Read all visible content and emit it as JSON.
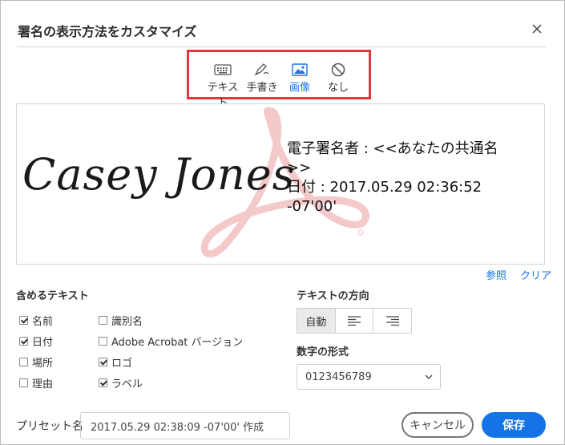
{
  "dialog": {
    "title": "署名の表示方法をカスタマイズ"
  },
  "modes": [
    {
      "label": "テキスト",
      "icon": "keyboard-icon"
    },
    {
      "label": "手書き",
      "icon": "pen-icon"
    },
    {
      "label": "画像",
      "icon": "image-icon",
      "active": true
    },
    {
      "label": "なし",
      "icon": "none-icon"
    }
  ],
  "preview": {
    "signature_name": "Casey Jones",
    "lines": [
      "電子署名者 : <<あなたの共通名",
      ">>",
      "日付 : 2017.05.29 02:36:52",
      "-07'00'"
    ]
  },
  "links": {
    "browse": "参照",
    "clear": "クリア"
  },
  "include_text": {
    "label": "含めるテキスト",
    "items": [
      {
        "label": "名前",
        "checked": true
      },
      {
        "label": "識別名",
        "checked": false
      },
      {
        "label": "日付",
        "checked": true
      },
      {
        "label": "Adobe Acrobat バージョン",
        "checked": false
      },
      {
        "label": "場所",
        "checked": false
      },
      {
        "label": "ロゴ",
        "checked": true
      },
      {
        "label": "理由",
        "checked": false
      },
      {
        "label": "ラベル",
        "checked": true
      }
    ]
  },
  "text_direction": {
    "label": "テキストの方向",
    "auto": "自動"
  },
  "number_format": {
    "label": "数字の形式",
    "value": "0123456789"
  },
  "preset": {
    "label": "プリセット名",
    "value": "2017.05.29 02:38:09 -07'00' 作成"
  },
  "buttons": {
    "cancel": "キャンセル",
    "save": "保存"
  },
  "colors": {
    "accent": "#1473e6",
    "highlight": "#e8343c",
    "watermark": "#f4c9c9"
  }
}
